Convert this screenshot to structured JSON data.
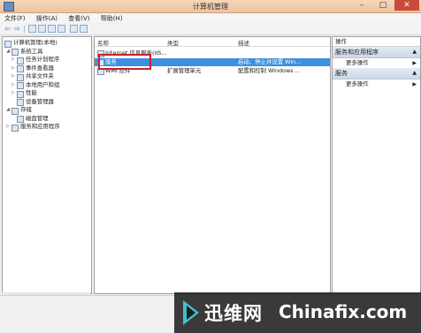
{
  "window": {
    "title": "计算机管理"
  },
  "menu": [
    "文件(F)",
    "操作(A)",
    "查看(V)",
    "帮助(H)"
  ],
  "tree": [
    {
      "label": "计算机管理(本地)",
      "depth": 0,
      "expander": ""
    },
    {
      "label": "系统工具",
      "depth": 1,
      "expander": "◢"
    },
    {
      "label": "任务计划程序",
      "depth": 2,
      "expander": "▷"
    },
    {
      "label": "事件查看器",
      "depth": 2,
      "expander": "▷"
    },
    {
      "label": "共享文件夹",
      "depth": 2,
      "expander": "▷"
    },
    {
      "label": "本地用户和组",
      "depth": 2,
      "expander": "▷"
    },
    {
      "label": "性能",
      "depth": 2,
      "expander": "▷"
    },
    {
      "label": "设备管理器",
      "depth": 2,
      "expander": ""
    },
    {
      "label": "存储",
      "depth": 1,
      "expander": "◢"
    },
    {
      "label": "磁盘管理",
      "depth": 2,
      "expander": ""
    },
    {
      "label": "服务和应用程序",
      "depth": 1,
      "expander": "▷"
    }
  ],
  "list": {
    "columns": {
      "name": "名称",
      "type": "类型",
      "desc": "描述"
    },
    "rows": [
      {
        "name": "Internet 信息服务(IIS...",
        "type": "",
        "desc": ""
      },
      {
        "name": "服务",
        "type": "",
        "desc": "启动、停止并设置 Win..."
      },
      {
        "name": "WMI 控件",
        "type": "扩展管理单元",
        "desc": "配置和控制 Windows ..."
      }
    ]
  },
  "actions": {
    "header": "操作",
    "sections": [
      {
        "title": "服务和应用程序",
        "item": "更多操作"
      },
      {
        "title": "服务",
        "item": "更多操作"
      }
    ]
  },
  "watermark": {
    "cn": "迅维网",
    "en": "Chinafix.com"
  }
}
